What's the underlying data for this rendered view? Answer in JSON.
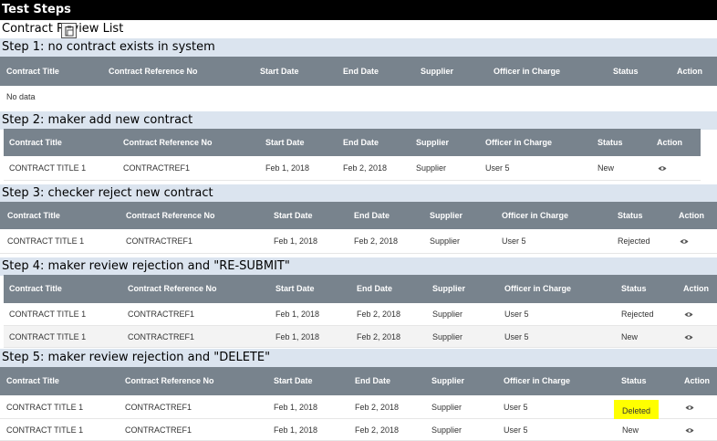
{
  "header": {
    "title": "Test Steps",
    "subtitle": "Contract Review List"
  },
  "columns": [
    "Contract Title",
    "Contract Reference No",
    "Start Date",
    "End Date",
    "Supplier",
    "Officer in Charge",
    "Status",
    "Action"
  ],
  "steps": [
    {
      "label": "Step 1: no contract exists in system",
      "empty_text": "No data",
      "rows": []
    },
    {
      "label": "Step 2: maker add new contract",
      "rows": [
        {
          "title": "CONTRACT TITLE 1",
          "ref": "CONTRACTREF1",
          "start": "Feb 1, 2018",
          "end": "Feb 2, 2018",
          "supplier": "Supplier",
          "officer": "User 5",
          "status": "New",
          "action_icon": "eye-icon"
        }
      ]
    },
    {
      "label": "Step 3: checker reject new contract",
      "rows": [
        {
          "title": "CONTRACT TITLE 1",
          "ref": "CONTRACTREF1",
          "start": "Feb 1, 2018",
          "end": "Feb 2, 2018",
          "supplier": "Supplier",
          "officer": "User 5",
          "status": "Rejected",
          "action_icon": "eye-icon"
        }
      ]
    },
    {
      "label": "Step 4: maker review rejection and \"RE-SUBMIT\"",
      "rows": [
        {
          "title": "CONTRACT TITLE 1",
          "ref": "CONTRACTREF1",
          "start": "Feb 1, 2018",
          "end": "Feb 2, 2018",
          "supplier": "Supplier",
          "officer": "User 5",
          "status": "Rejected",
          "action_icon": "eye-icon"
        },
        {
          "title": "CONTRACT TITLE 1",
          "ref": "CONTRACTREF1",
          "start": "Feb 1, 2018",
          "end": "Feb 2, 2018",
          "supplier": "Supplier",
          "officer": "User 5",
          "status": "New",
          "action_icon": "eye-icon"
        }
      ]
    },
    {
      "label": "Step 5: maker review rejection and \"DELETE\"",
      "rows": [
        {
          "title": "CONTRACT TITLE 1",
          "ref": "CONTRACTREF1",
          "start": "Feb 1, 2018",
          "end": "Feb 2, 2018",
          "supplier": "Supplier",
          "officer": "User 5",
          "status": "Deleted",
          "action_icon": "eye-icon"
        },
        {
          "title": "CONTRACT TITLE 1",
          "ref": "CONTRACTREF1",
          "start": "Feb 1, 2018",
          "end": "Feb 2, 2018",
          "supplier": "Supplier",
          "officer": "User 5",
          "status": "New",
          "action_icon": "eye-icon"
        }
      ]
    }
  ],
  "colors": {
    "header_bg": "#78838d",
    "step_bg": "#dbe4ef",
    "highlight": "#ffff00"
  }
}
